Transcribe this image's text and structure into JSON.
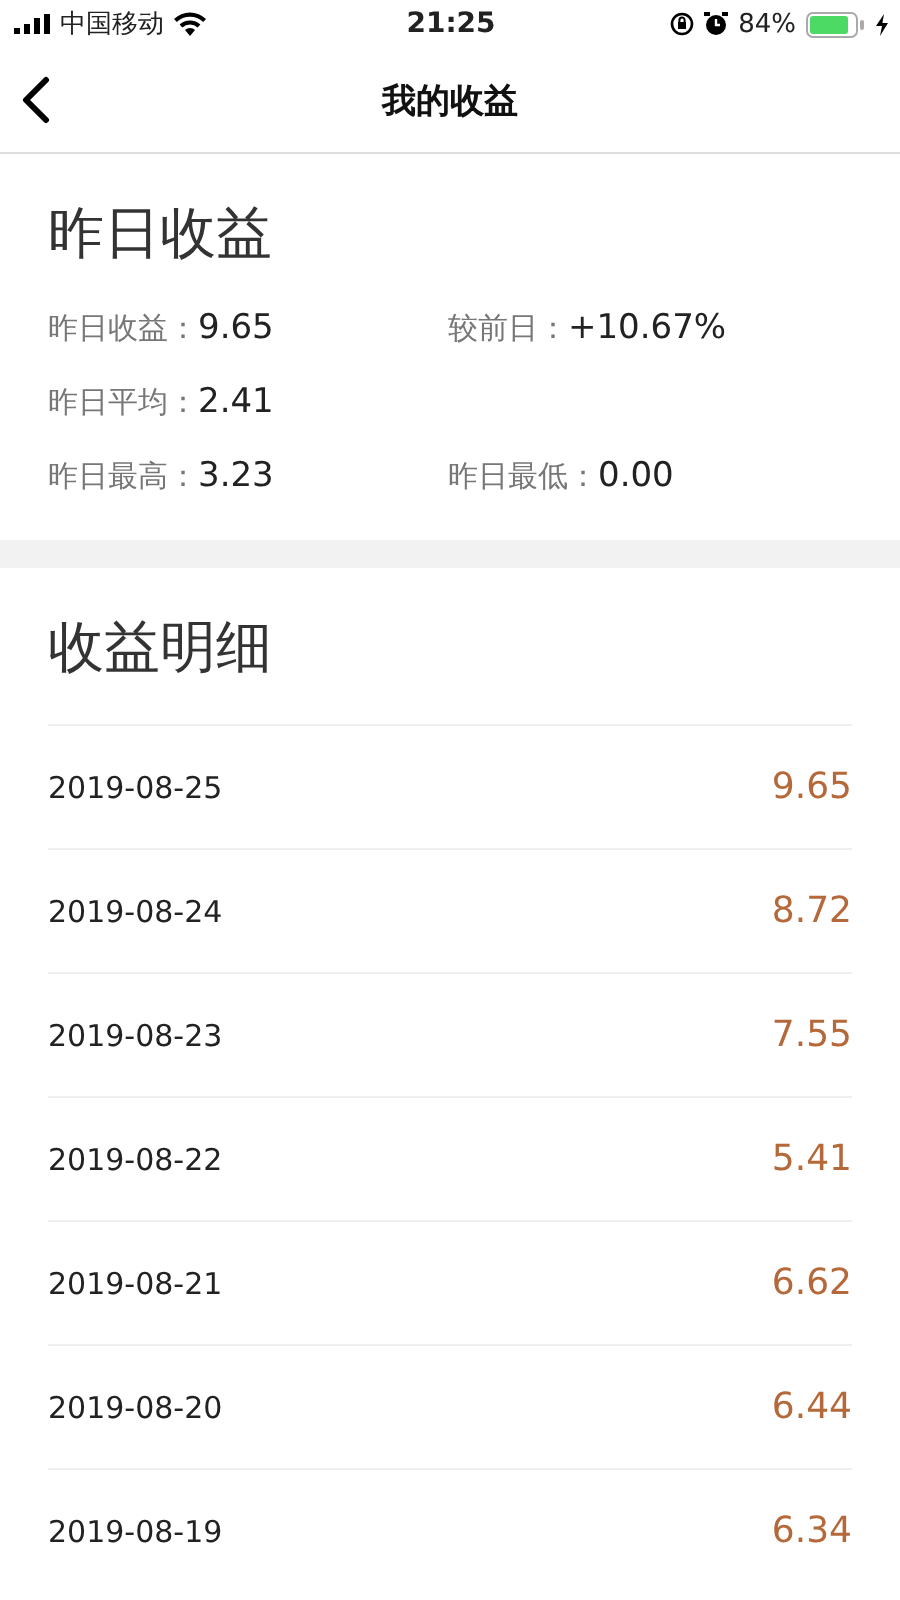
{
  "status_bar": {
    "carrier": "中国移动",
    "time": "21:25",
    "battery": "84%"
  },
  "nav": {
    "title": "我的收益"
  },
  "summary": {
    "title": "昨日收益",
    "rows": [
      [
        {
          "label": "昨日收益：",
          "value": "9.65"
        },
        {
          "label": "较前日：",
          "value": "+10.67%"
        }
      ],
      [
        {
          "label": "昨日平均：",
          "value": "2.41"
        }
      ],
      [
        {
          "label": "昨日最高：",
          "value": "3.23"
        },
        {
          "label": "昨日最低：",
          "value": "0.00"
        }
      ]
    ]
  },
  "details": {
    "title": "收益明细",
    "rows": [
      {
        "date": "2019-08-25",
        "amount": "9.65"
      },
      {
        "date": "2019-08-24",
        "amount": "8.72"
      },
      {
        "date": "2019-08-23",
        "amount": "7.55"
      },
      {
        "date": "2019-08-22",
        "amount": "5.41"
      },
      {
        "date": "2019-08-21",
        "amount": "6.62"
      },
      {
        "date": "2019-08-20",
        "amount": "6.44"
      },
      {
        "date": "2019-08-19",
        "amount": "6.34"
      }
    ]
  }
}
